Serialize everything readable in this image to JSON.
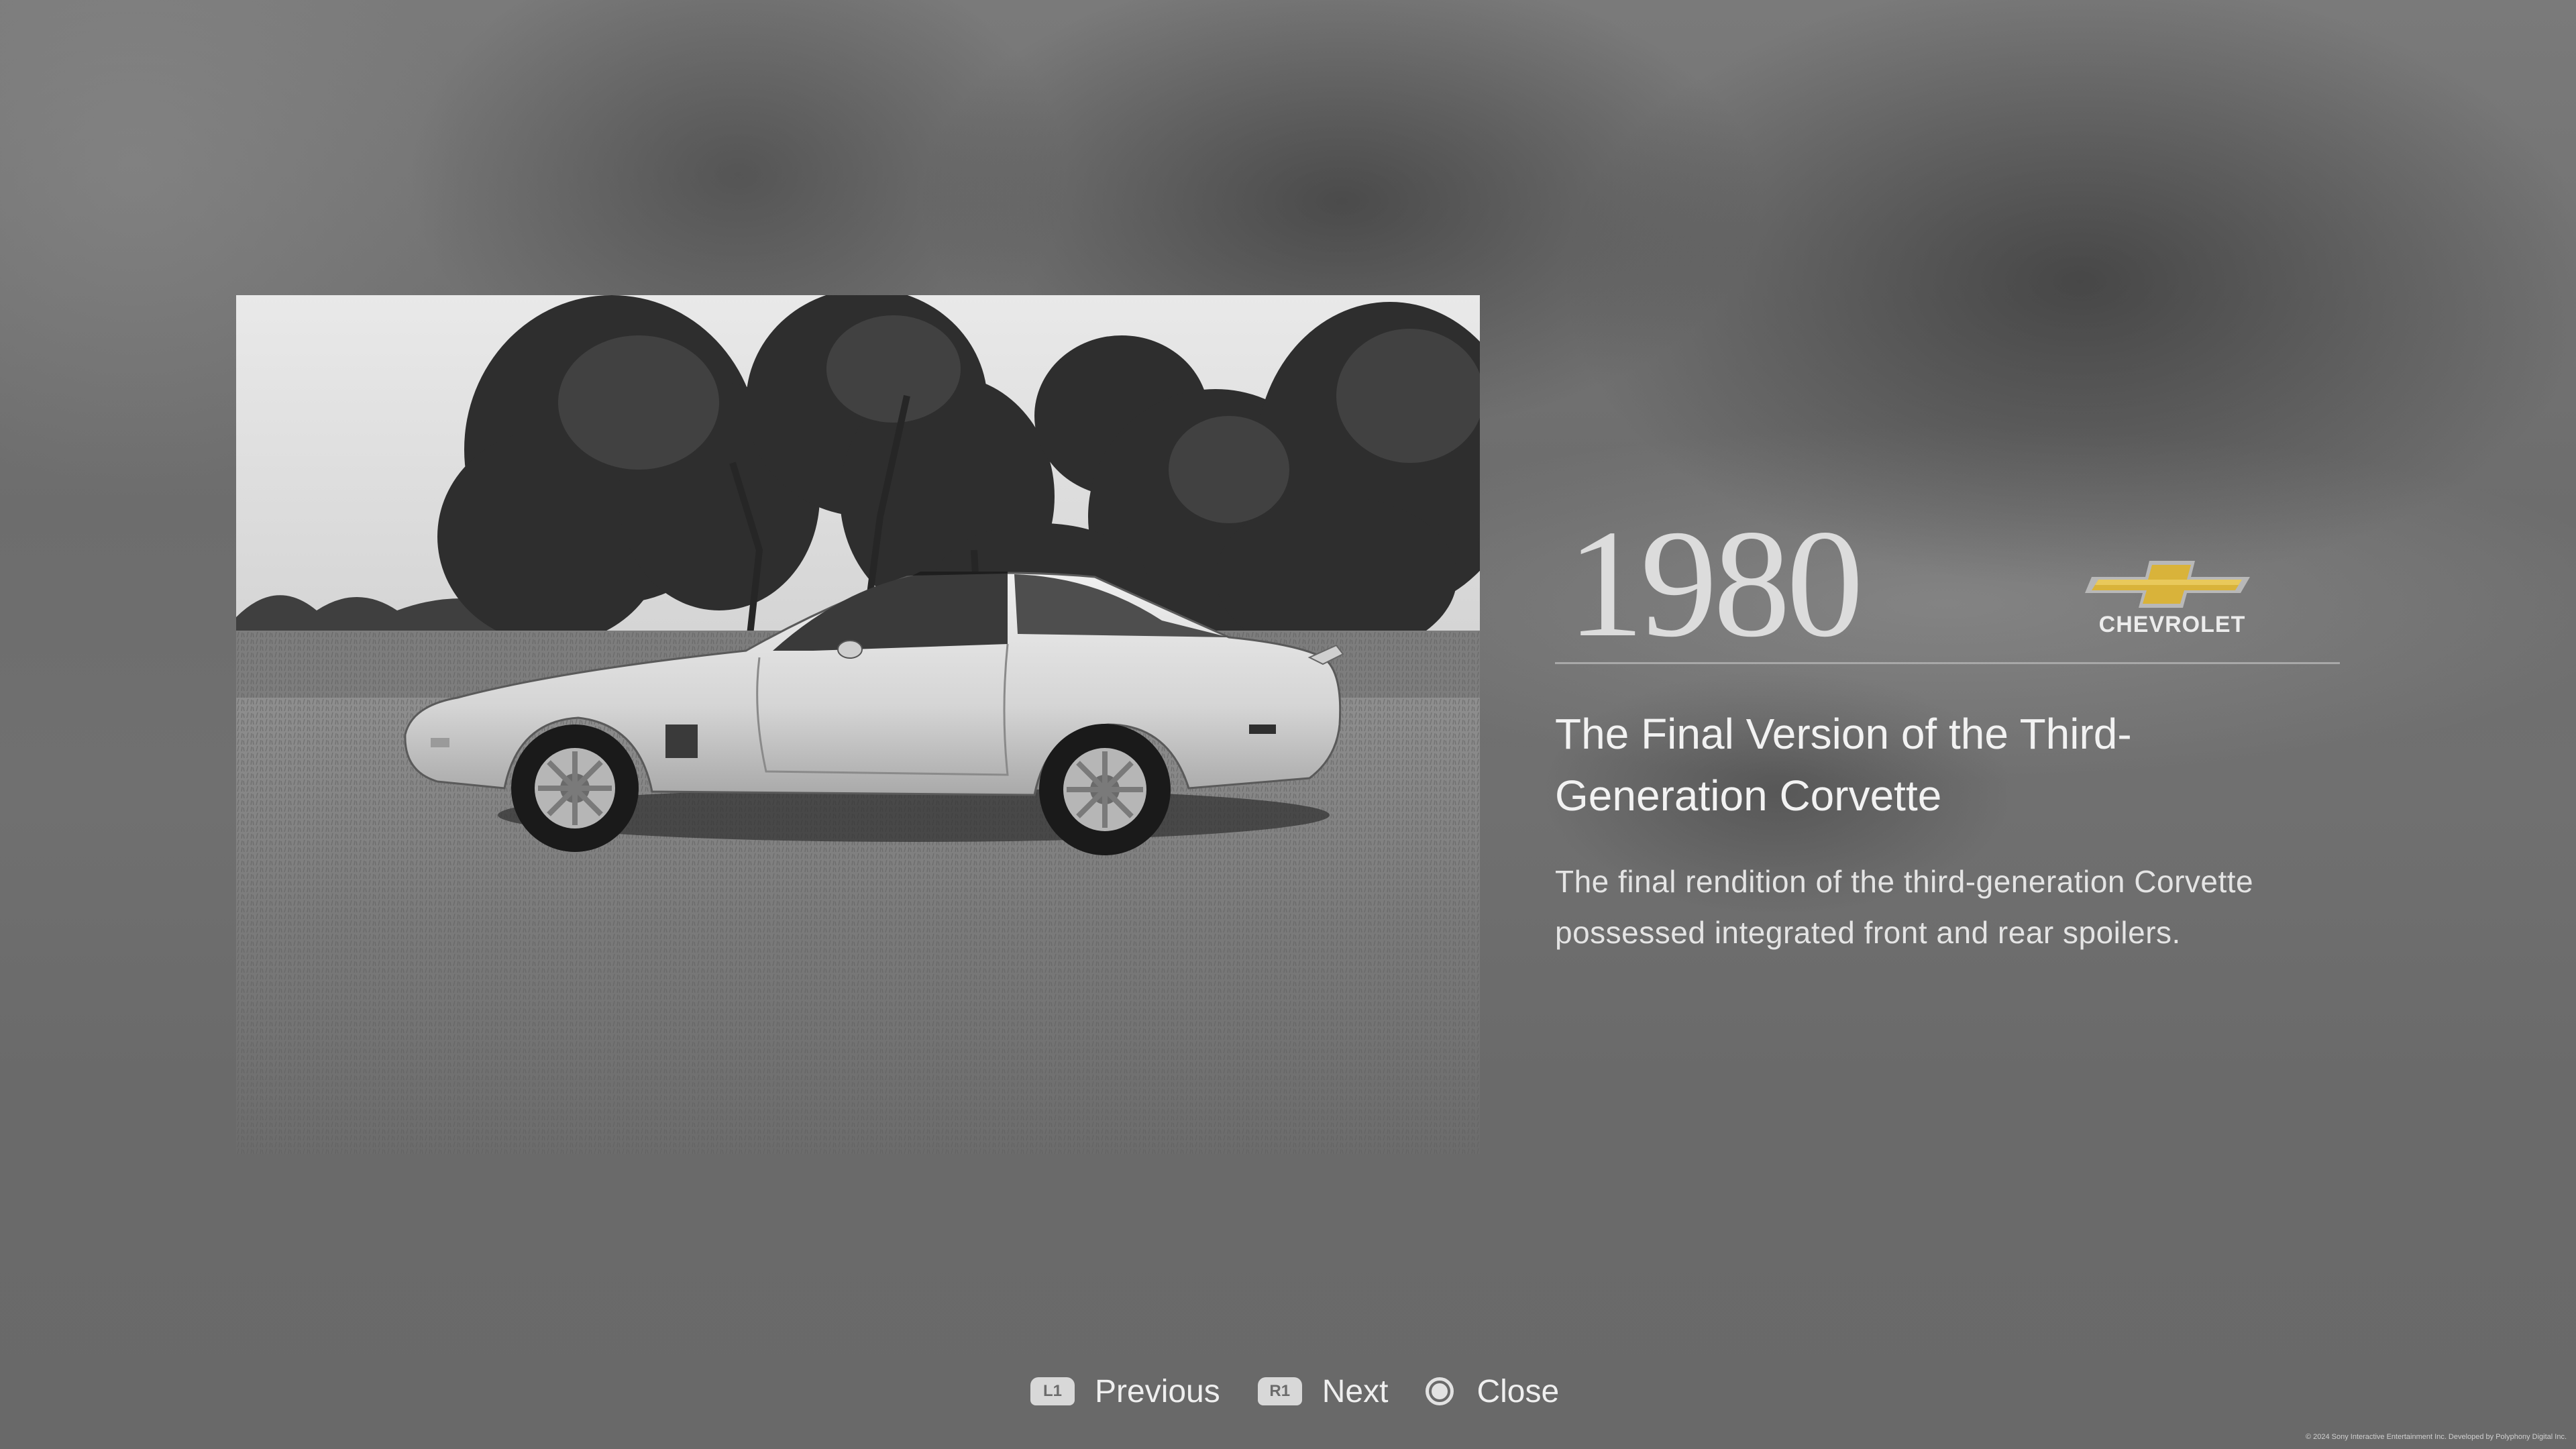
{
  "photo": {
    "caption": "1980 Chevrolet Corvette side profile, black and white photograph"
  },
  "info": {
    "year": "1980",
    "brand": "CHEVROLET",
    "brand_logo_color": "#d9b33a",
    "headline": "The Final Version of the Third-Generation Corvette",
    "description": "The final rendition of the third-generation Corvette possessed integrated front and rear spoilers."
  },
  "controls": {
    "previous": {
      "button": "L1",
      "label": "Previous"
    },
    "next": {
      "button": "R1",
      "label": "Next"
    },
    "close": {
      "button": "circle-icon",
      "label": "Close"
    }
  },
  "footer": {
    "copyright": "© 2024 Sony Interactive Entertainment Inc. Developed by Polyphony Digital Inc."
  }
}
